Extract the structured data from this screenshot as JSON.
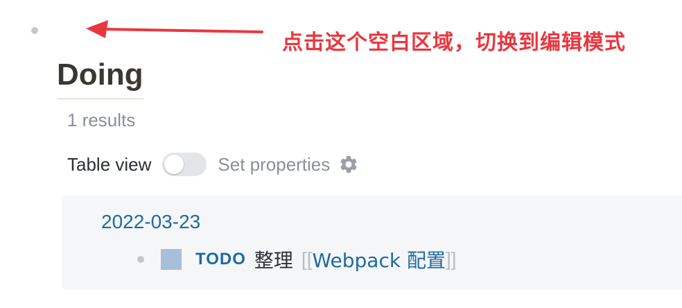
{
  "annotation": {
    "text": "点击这个空白区域，切换到编辑模式",
    "color": "#e8373f"
  },
  "query": {
    "title": "Doing",
    "results_text": "1 results",
    "table_view_label": "Table view",
    "table_view_enabled": false,
    "set_properties_label": "Set properties"
  },
  "result": {
    "date": "2022-03-23",
    "task": {
      "marker": "TODO",
      "text": "整理",
      "open_bracket": "[[",
      "page_ref": "Webpack 配置",
      "close_bracket": "]]"
    }
  },
  "icons": {
    "bullet": "bullet-dot-icon",
    "settings": "gear-icon",
    "checkbox": "checkbox-icon",
    "arrow": "arrow-left-icon"
  },
  "colors": {
    "link": "#1d6aa3",
    "panel_bg": "#f5f6f7"
  }
}
